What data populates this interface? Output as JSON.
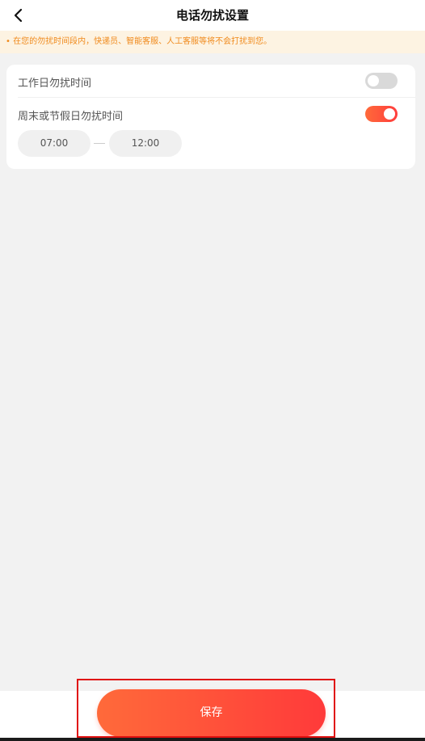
{
  "header": {
    "title": "电话勿扰设置",
    "back_icon": "chevron-left-icon"
  },
  "notice": {
    "text": "• 在您的勿扰时间段内，快递员、智能客服、人工客服等将不会打扰到您。",
    "color": "#f08a1c",
    "background": "#fdf3e2"
  },
  "settings": {
    "weekday": {
      "label": "工作日勿扰时间",
      "enabled": false
    },
    "weekend": {
      "label": "周末或节假日勿扰时间",
      "enabled": true
    },
    "time_range": {
      "start": "07:00",
      "end": "12:00"
    }
  },
  "footer": {
    "save_label": "保存",
    "accent": "#ff4a3a"
  }
}
